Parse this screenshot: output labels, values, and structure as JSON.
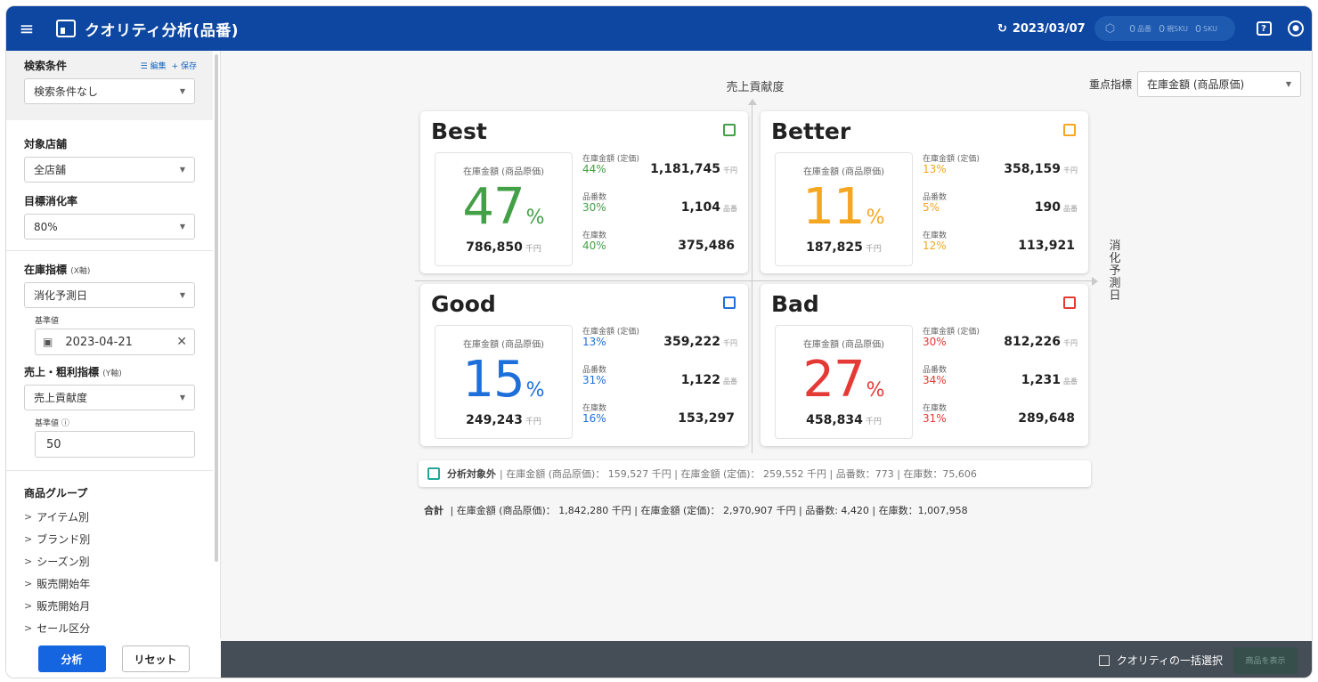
{
  "header": {
    "title": "クオリティ分析(品番)",
    "date": "2023/03/07",
    "counts": [
      {
        "value": "0",
        "label": "品番"
      },
      {
        "value": "0",
        "label": "親SKU"
      },
      {
        "value": "0",
        "label": "SKU"
      }
    ]
  },
  "sidebar": {
    "search_conditions": {
      "label": "検索条件",
      "edit": "編集",
      "save": "保存",
      "value": "検索条件なし"
    },
    "target_store": {
      "label": "対象店舗",
      "value": "全店舗"
    },
    "target_rate": {
      "label": "目標消化率",
      "value": "80%"
    },
    "stock_index": {
      "label": "在庫指標",
      "axis": "(X軸)",
      "value": "消化予測日",
      "base_label": "基準値",
      "base_value": "2023-04-21"
    },
    "sales_index": {
      "label": "売上・粗利指標",
      "axis": "(Y軸)",
      "value": "売上貢献度",
      "base_label": "基準値 ⓘ",
      "base_value": "50"
    },
    "product_group": {
      "label": "商品グループ",
      "items": [
        "アイテム別",
        "ブランド別",
        "シーズン別",
        "販売開始年",
        "販売開始月",
        "セール区分"
      ]
    },
    "analyze_button": "分析",
    "reset_button": "リセット"
  },
  "main": {
    "y_axis_label": "売上貢献度",
    "x_axis_label": "消化予測日",
    "focus_label": "重点指標",
    "focus_value": "在庫金額 (商品原価)",
    "cards": [
      {
        "title": "Best",
        "color": "#43a047",
        "pct": "47",
        "pct_symbol": "%",
        "inner_label": "在庫金額 (商品原価)",
        "inner_value": "786,850",
        "inner_unit": "千円",
        "metrics": [
          {
            "label": "在庫金額 (定価)",
            "pct": "44%",
            "value": "1,181,745",
            "unit": "千円"
          },
          {
            "label": "品番数",
            "pct": "30%",
            "value": "1,104",
            "unit": "品番"
          },
          {
            "label": "在庫数",
            "pct": "40%",
            "value": "375,486",
            "unit": ""
          }
        ]
      },
      {
        "title": "Better",
        "color": "#f5a623",
        "pct": "11",
        "pct_symbol": "%",
        "inner_label": "在庫金額 (商品原価)",
        "inner_value": "187,825",
        "inner_unit": "千円",
        "metrics": [
          {
            "label": "在庫金額 (定価)",
            "pct": "13%",
            "value": "358,159",
            "unit": "千円"
          },
          {
            "label": "品番数",
            "pct": "5%",
            "value": "190",
            "unit": "品番"
          },
          {
            "label": "在庫数",
            "pct": "12%",
            "value": "113,921",
            "unit": ""
          }
        ]
      },
      {
        "title": "Good",
        "color": "#1e6fd9",
        "pct": "15",
        "pct_symbol": "%",
        "inner_label": "在庫金額 (商品原価)",
        "inner_value": "249,243",
        "inner_unit": "千円",
        "metrics": [
          {
            "label": "在庫金額 (定価)",
            "pct": "13%",
            "value": "359,222",
            "unit": "千円"
          },
          {
            "label": "品番数",
            "pct": "31%",
            "value": "1,122",
            "unit": "品番"
          },
          {
            "label": "在庫数",
            "pct": "16%",
            "value": "153,297",
            "unit": ""
          }
        ]
      },
      {
        "title": "Bad",
        "color": "#e53935",
        "pct": "27",
        "pct_symbol": "%",
        "inner_label": "在庫金額 (商品原価)",
        "inner_value": "458,834",
        "inner_unit": "千円",
        "metrics": [
          {
            "label": "在庫金額 (定価)",
            "pct": "30%",
            "value": "812,226",
            "unit": "千円"
          },
          {
            "label": "品番数",
            "pct": "34%",
            "value": "1,231",
            "unit": "品番"
          },
          {
            "label": "在庫数",
            "pct": "31%",
            "value": "289,648",
            "unit": ""
          }
        ]
      }
    ],
    "excluded": {
      "title": "分析対象外",
      "text": "| 在庫金額 (商品原価)： 159,527 千円 | 在庫金額 (定価)： 259,552 千円 | 品番数：773 | 在庫数：75,606"
    },
    "total": {
      "title": "合計",
      "text": "| 在庫金額 (商品原価)： 1,842,280 千円 | 在庫金額 (定価)： 2,970,907 千円 | 品番数: 4,420 | 在庫数：1,007,958"
    }
  },
  "footer": {
    "bulk_select": "クオリティの一括選択",
    "show_products": "商品を表示"
  }
}
